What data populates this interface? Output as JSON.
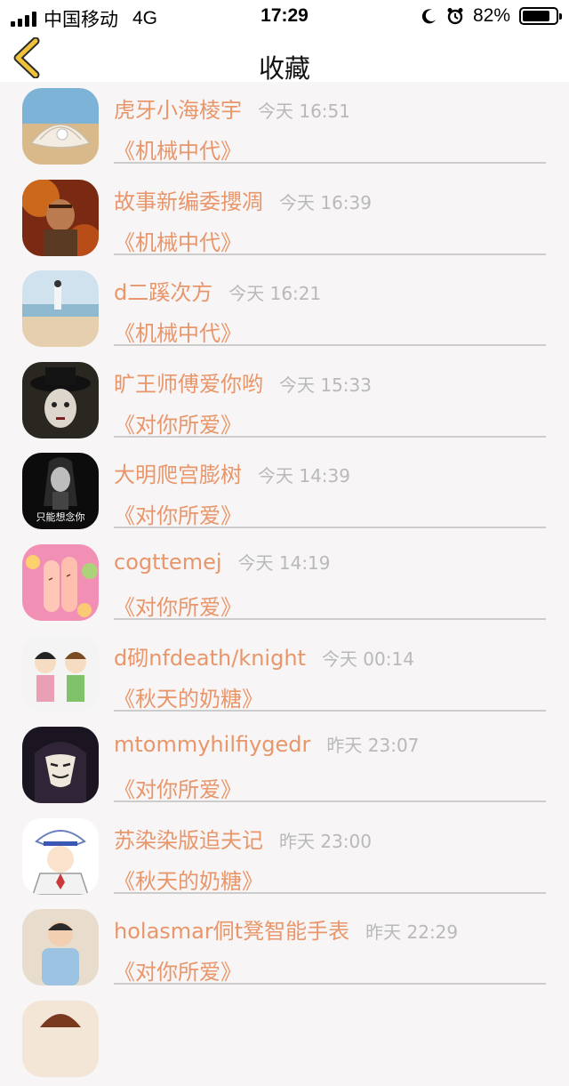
{
  "status_bar": {
    "carrier": "中国移动",
    "network": "4G",
    "time": "17:29",
    "battery": "82%",
    "battery_level": 0.82
  },
  "nav": {
    "title": "收藏",
    "back_icon": "chevron-left-icon"
  },
  "colors": {
    "accent": "#e8966a",
    "time_text": "#b9b9b9",
    "back_arrow": "#f0c23b"
  },
  "items": [
    {
      "name": "虎牙小海棱宇",
      "time": "今天 16:51",
      "book": "《机械中代》"
    },
    {
      "name": "故事新编委攖凋",
      "time": "今天 16:39",
      "book": "《机械中代》"
    },
    {
      "name": "d二蹊次方",
      "time": "今天 16:21",
      "book": "《机械中代》"
    },
    {
      "name": "旷王师傅爱你哟",
      "time": "今天 15:33",
      "book": "《对你所爱》"
    },
    {
      "name": "大明爬宫膨树",
      "time": "今天 14:39",
      "book": "《对你所爱》",
      "avatar_text": "只能想念你"
    },
    {
      "name": "cogttemej",
      "time": "今天 14:19",
      "book": "《对你所爱》"
    },
    {
      "name": "d砌nfdeath/knight",
      "time": "今天 00:14",
      "book": "《秋天的奶糖》"
    },
    {
      "name": "mtommyhilfiygedr",
      "time": "昨天 23:07",
      "book": "《对你所爱》"
    },
    {
      "name": "苏染染版追夫记",
      "time": "昨天 23:00",
      "book": "《秋天的奶糖》"
    },
    {
      "name": "holasmar侗t凳智能手表",
      "time": "昨天 22:29",
      "book": "《对你所爱》"
    }
  ]
}
